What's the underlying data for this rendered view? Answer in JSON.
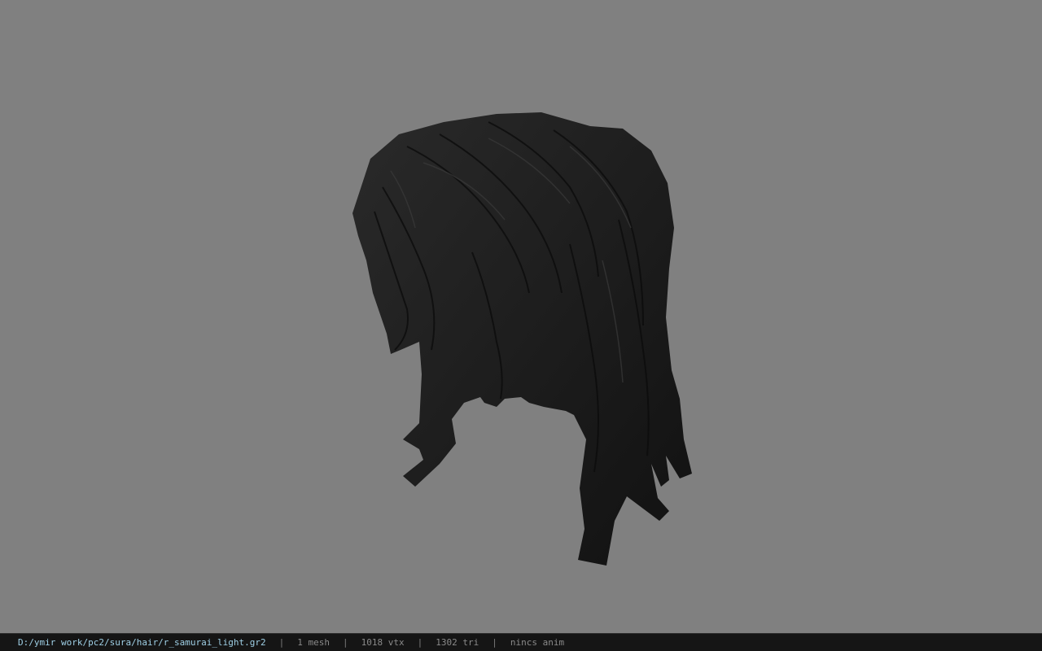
{
  "viewer": {
    "background_color": "#808080",
    "model_color": "#1b1b1b",
    "model_icon": "hair-mesh-icon"
  },
  "status": {
    "path": "D:/ymir work/pc2/sura/hair/r_samurai_light.gr2",
    "sep": "|",
    "mesh": "1 mesh",
    "vtx": "1018 vtx",
    "tri": "1302 tri",
    "anim": "nincs anim"
  }
}
